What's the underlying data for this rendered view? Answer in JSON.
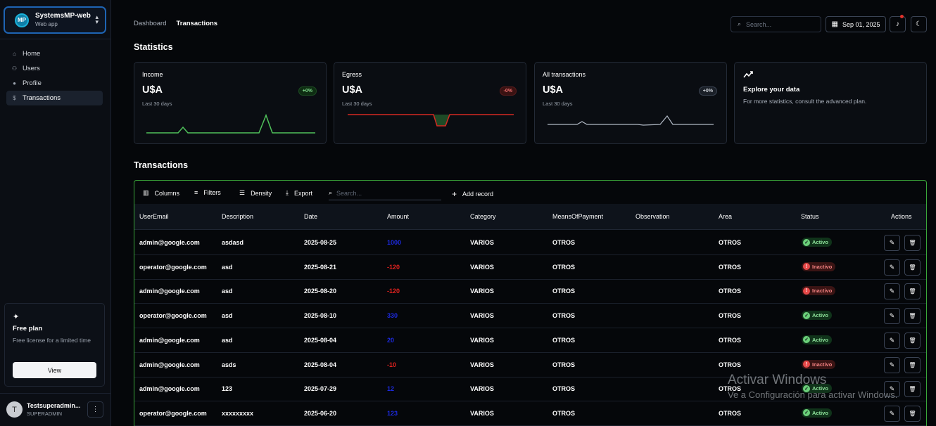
{
  "sidebar": {
    "app": {
      "logo": "MP",
      "name": "SystemsMP-web",
      "subtitle": "Web app",
      "chevron": "⌃⌄"
    },
    "nav": [
      {
        "label": "Home",
        "icon": "home-icon",
        "glyph": "⌂",
        "active": false
      },
      {
        "label": "Users",
        "icon": "users-icon",
        "glyph": "👥",
        "active": false
      },
      {
        "label": "Profile",
        "icon": "person-icon",
        "glyph": "●",
        "active": false
      },
      {
        "label": "Transactions",
        "icon": "dollar-icon",
        "glyph": "$",
        "active": true
      }
    ],
    "plan": {
      "icon": "sparkle-icon",
      "glyph": "✦",
      "title": "Free plan",
      "description": "Free license for a limited time",
      "button": "View"
    },
    "user": {
      "avatar": "T",
      "name": "Testsuperadmin...",
      "role": "SUPERADMIN",
      "menu_glyph": "⋮"
    }
  },
  "header": {
    "breadcrumb": [
      "Dashboard",
      "Transactions"
    ],
    "search_placeholder": "Search...",
    "date": "Sep 01, 2025",
    "bell_glyph": "🔔",
    "theme_glyph": "☾"
  },
  "statistics": {
    "title": "Statistics",
    "cards": [
      {
        "title": "Income",
        "value": "U$A",
        "period": "Last 30 days",
        "badge": "+0%",
        "trend": "up",
        "color": "#4fc25a"
      },
      {
        "title": "Egress",
        "value": "U$A",
        "period": "Last 30 days",
        "badge": "-0%",
        "trend": "down",
        "color": "#d42a22"
      },
      {
        "title": "All transactions",
        "value": "U$A",
        "period": "Last 30 days",
        "badge": "+0%",
        "trend": "neutral",
        "color": "#b0b8c4"
      }
    ],
    "explore": {
      "icon": "trending-icon",
      "glyph": "↗",
      "title": "Explore your data",
      "description": "For more statistics, consult the advanced plan."
    }
  },
  "transactions": {
    "title": "Transactions",
    "toolbar": {
      "columns": "Columns",
      "filters": "Filters",
      "density": "Density",
      "export": "Export",
      "search_placeholder": "Search...",
      "add": "Add record"
    },
    "columns": [
      "UserEmail",
      "Description",
      "Date",
      "Amount",
      "Category",
      "MeansOfPayment",
      "Observation",
      "Area",
      "Status",
      "Actions"
    ],
    "rows": [
      {
        "email": "admin@google.com",
        "description": "asdasd",
        "date": "2025-08-25",
        "amount": "1000",
        "category": "VARIOS",
        "payment": "OTROS",
        "observation": "",
        "area": "OTROS",
        "status": "Activo"
      },
      {
        "email": "operator@google.com",
        "description": "asd",
        "date": "2025-08-21",
        "amount": "-120",
        "category": "VARIOS",
        "payment": "OTROS",
        "observation": "",
        "area": "OTROS",
        "status": "Inactivo"
      },
      {
        "email": "admin@google.com",
        "description": "asd",
        "date": "2025-08-20",
        "amount": "-120",
        "category": "VARIOS",
        "payment": "OTROS",
        "observation": "",
        "area": "OTROS",
        "status": "Inactivo"
      },
      {
        "email": "operator@google.com",
        "description": "asd",
        "date": "2025-08-10",
        "amount": "330",
        "category": "VARIOS",
        "payment": "OTROS",
        "observation": "",
        "area": "OTROS",
        "status": "Activo"
      },
      {
        "email": "admin@google.com",
        "description": "asd",
        "date": "2025-08-04",
        "amount": "20",
        "category": "VARIOS",
        "payment": "OTROS",
        "observation": "",
        "area": "OTROS",
        "status": "Activo"
      },
      {
        "email": "admin@google.com",
        "description": "asds",
        "date": "2025-08-04",
        "amount": "-10",
        "category": "VARIOS",
        "payment": "OTROS",
        "observation": "",
        "area": "OTROS",
        "status": "Inactivo"
      },
      {
        "email": "admin@google.com",
        "description": "123",
        "date": "2025-07-29",
        "amount": "12",
        "category": "VARIOS",
        "payment": "OTROS",
        "observation": "",
        "area": "OTROS",
        "status": "Activo"
      },
      {
        "email": "operator@google.com",
        "description": "xxxxxxxxx",
        "date": "2025-06-20",
        "amount": "123",
        "category": "VARIOS",
        "payment": "OTROS",
        "observation": "",
        "area": "OTROS",
        "status": "Activo"
      }
    ]
  },
  "watermark": {
    "line1": "Activar Windows",
    "line2": "Ve a Configuración para activar Windows."
  }
}
